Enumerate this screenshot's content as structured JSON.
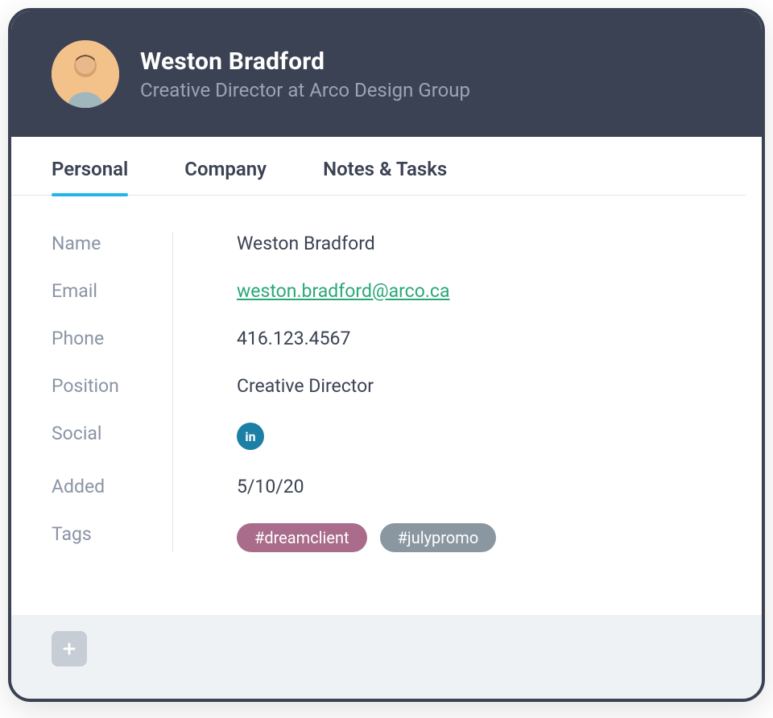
{
  "header": {
    "name": "Weston Bradford",
    "subtitle": "Creative Director at Arco Design Group"
  },
  "tabs": {
    "personal": "Personal",
    "company": "Company",
    "notes": "Notes & Tasks"
  },
  "labels": {
    "name": "Name",
    "email": "Email",
    "phone": "Phone",
    "position": "Position",
    "social": "Social",
    "added": "Added",
    "tags": "Tags"
  },
  "personal": {
    "name": "Weston Bradford",
    "email": "weston.bradford@arco.ca",
    "phone": "416.123.4567",
    "position": "Creative Director",
    "social_icon": "linkedin",
    "added": "5/10/20",
    "tags": [
      {
        "label": "#dreamclient",
        "color": "#A96C8B"
      },
      {
        "label": "#julypromo",
        "color": "#8A97A0"
      }
    ]
  },
  "colors": {
    "accent": "#1FB6E8",
    "link": "#2AA876"
  }
}
